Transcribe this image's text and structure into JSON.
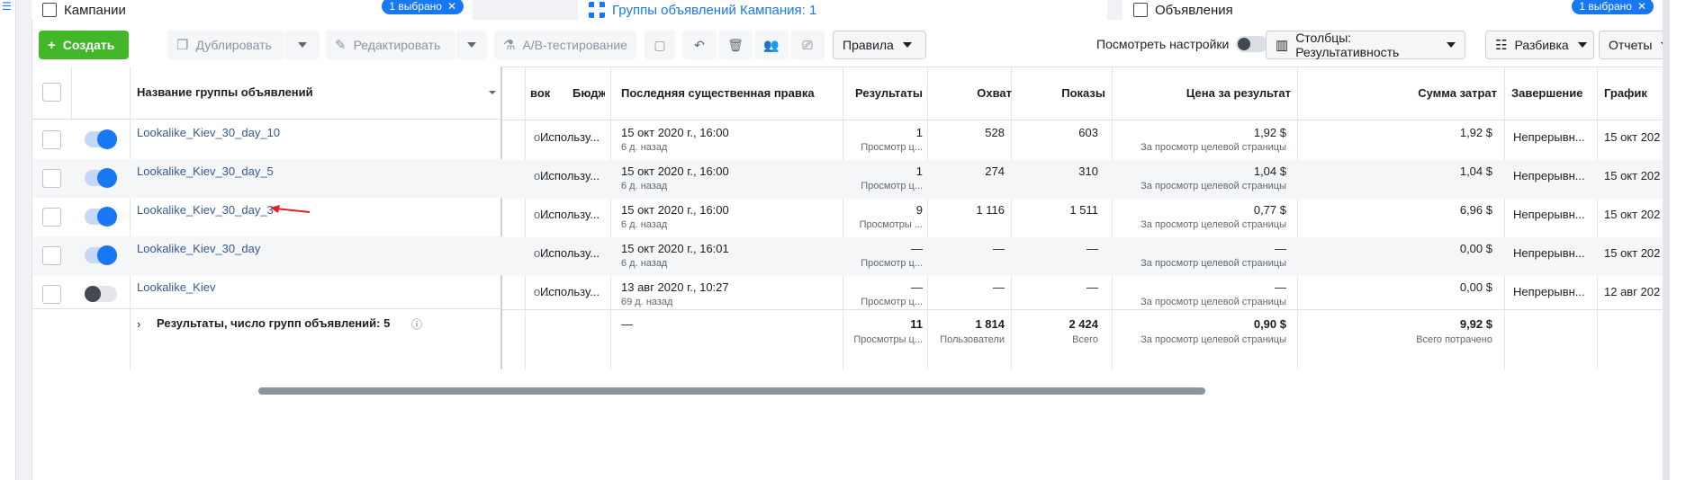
{
  "tabs": [
    {
      "title": "Кампании",
      "badge": "1 выбрано"
    },
    {
      "title": "Группы объявлений Кампания: 1",
      "badge": ""
    },
    {
      "title": "Объявления",
      "badge": "1 выбрано"
    }
  ],
  "toolbar": {
    "create": "Создать",
    "duplicate": "Дублировать",
    "edit": "Редактировать",
    "ab_test": "A/B-тестирование",
    "rules": "Правила",
    "view_settings": "Посмотреть настройки",
    "columns": "Столбцы: Результативность",
    "breakdown": "Разбивка",
    "reports": "Отчеты"
  },
  "headers": {
    "name": "Название группы объявлений",
    "partial": "вок",
    "budget": "Бюджет",
    "last_edit": "Последняя существенная правка",
    "results": "Результаты",
    "reach": "Охват",
    "impressions": "Показы",
    "cost_per_result": "Цена за результат",
    "amount_spent": "Сумма затрат",
    "ends": "Завершение",
    "schedule": "График"
  },
  "rows": [
    {
      "name": "Lookalike_Kiev_30_day_10",
      "on": true,
      "partial": "о...",
      "budget": "Использу...",
      "edit": "15 окт 2020 г., 16:00",
      "edit_sub": "6 д. назад",
      "results": "1",
      "results_sub": "Просмотр ц...",
      "reach": "528",
      "impressions": "603",
      "cpr": "1,92 $",
      "cpr_sub": "За просмотр целевой страницы",
      "spent": "1,92 $",
      "ends": "Непрерывн...",
      "schedule": "15 окт 202"
    },
    {
      "name": "Lookalike_Kiev_30_day_5",
      "on": true,
      "partial": "о...",
      "budget": "Использу...",
      "edit": "15 окт 2020 г., 16:00",
      "edit_sub": "6 д. назад",
      "results": "1",
      "results_sub": "Просмотр ц...",
      "reach": "274",
      "impressions": "310",
      "cpr": "1,04 $",
      "cpr_sub": "За просмотр целевой страницы",
      "spent": "1,04 $",
      "ends": "Непрерывн...",
      "schedule": "15 окт 202"
    },
    {
      "name": "Lookalike_Kiev_30_day_3",
      "on": true,
      "partial": "о...",
      "budget": "Использу...",
      "edit": "15 окт 2020 г., 16:00",
      "edit_sub": "6 д. назад",
      "results": "9",
      "results_sub": "Просмотры ...",
      "reach": "1 116",
      "impressions": "1 511",
      "cpr": "0,77 $",
      "cpr_sub": "За просмотр целевой страницы",
      "spent": "6,96 $",
      "ends": "Непрерывн...",
      "schedule": "15 окт 202"
    },
    {
      "name": "Lookalike_Kiev_30_day",
      "on": true,
      "partial": "о...",
      "budget": "Использу...",
      "edit": "15 окт 2020 г., 16:01",
      "edit_sub": "6 д. назад",
      "results": "—",
      "results_sub": "Просмотр ц...",
      "reach": "—",
      "impressions": "—",
      "cpr": "—",
      "cpr_sub": "За просмотр целевой страницы",
      "spent": "0,00 $",
      "ends": "Непрерывн...",
      "schedule": "15 окт 202"
    },
    {
      "name": "Lookalike_Kiev",
      "on": false,
      "partial": "о...",
      "budget": "Использу...",
      "edit": "13 авг 2020 г., 10:27",
      "edit_sub": "69 д. назад",
      "results": "—",
      "results_sub": "Просмотр ц...",
      "reach": "—",
      "impressions": "—",
      "cpr": "—",
      "cpr_sub": "За просмотр целевой страницы",
      "spent": "0,00 $",
      "ends": "Непрерывн...",
      "schedule": "12 авг 202"
    }
  ],
  "footer": {
    "label": "Результаты, число групп объявлений: 5",
    "edit": "—",
    "results": "11",
    "results_sub": "Просмотры ц...",
    "reach": "1 814",
    "reach_sub": "Пользователи",
    "impressions": "2 424",
    "impressions_sub": "Всего",
    "cpr": "0,90 $",
    "cpr_sub": "За просмотр целевой страницы",
    "spent": "9,92 $",
    "spent_sub": "Всего потрачено"
  },
  "colors": {
    "accent": "#1877f2",
    "create": "#42b72a",
    "link": "#385898",
    "annotation": "#e41e26"
  }
}
